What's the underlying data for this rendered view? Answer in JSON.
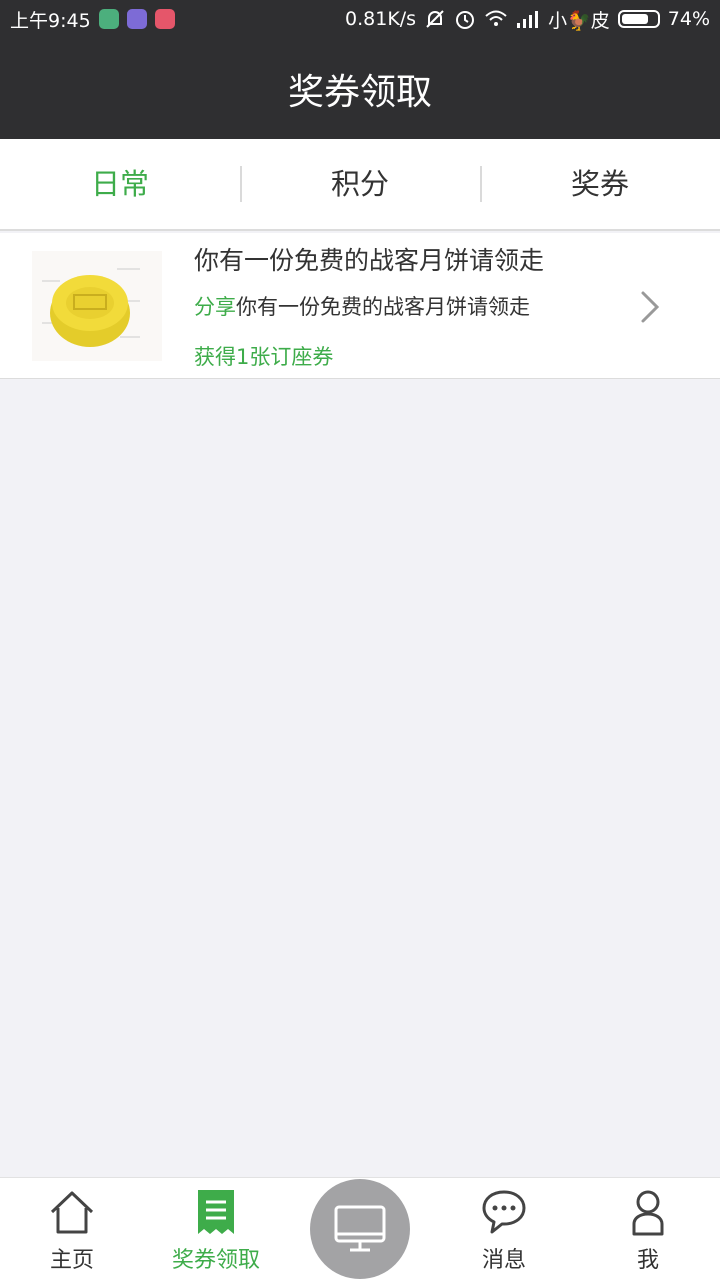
{
  "status_bar": {
    "time": "上午9:45",
    "network_speed": "0.81K/s",
    "carrier": "小🐓皮",
    "battery": "74%",
    "battery_level": 0.74,
    "app_icon_colors": [
      "#4caf7d",
      "#7d6bd6",
      "#e5566a"
    ]
  },
  "header": {
    "title": "奖券领取"
  },
  "tabs": [
    {
      "label": "日常",
      "active": true
    },
    {
      "label": "积分",
      "active": false
    },
    {
      "label": "奖券",
      "active": false
    }
  ],
  "items": [
    {
      "title": "你有一份免费的战客月饼请领走",
      "share_prefix": "分享",
      "subtitle": "你有一份免费的战客月饼请领走",
      "reward": "获得1张订座券",
      "thumbnail": "mooncake-image"
    }
  ],
  "bottom_nav": [
    {
      "label": "主页",
      "icon": "home-icon",
      "active": false
    },
    {
      "label": "奖券领取",
      "icon": "ticket-icon",
      "active": true
    },
    {
      "label": "",
      "icon": "monitor-icon",
      "active": false
    },
    {
      "label": "消息",
      "icon": "chat-icon",
      "active": false
    },
    {
      "label": "我",
      "icon": "user-icon",
      "active": false
    }
  ],
  "colors": {
    "accent": "#3eac4a",
    "header_bg": "#2f2f31",
    "page_bg": "#f2f2f6",
    "center_button": "#a3a3a5"
  }
}
